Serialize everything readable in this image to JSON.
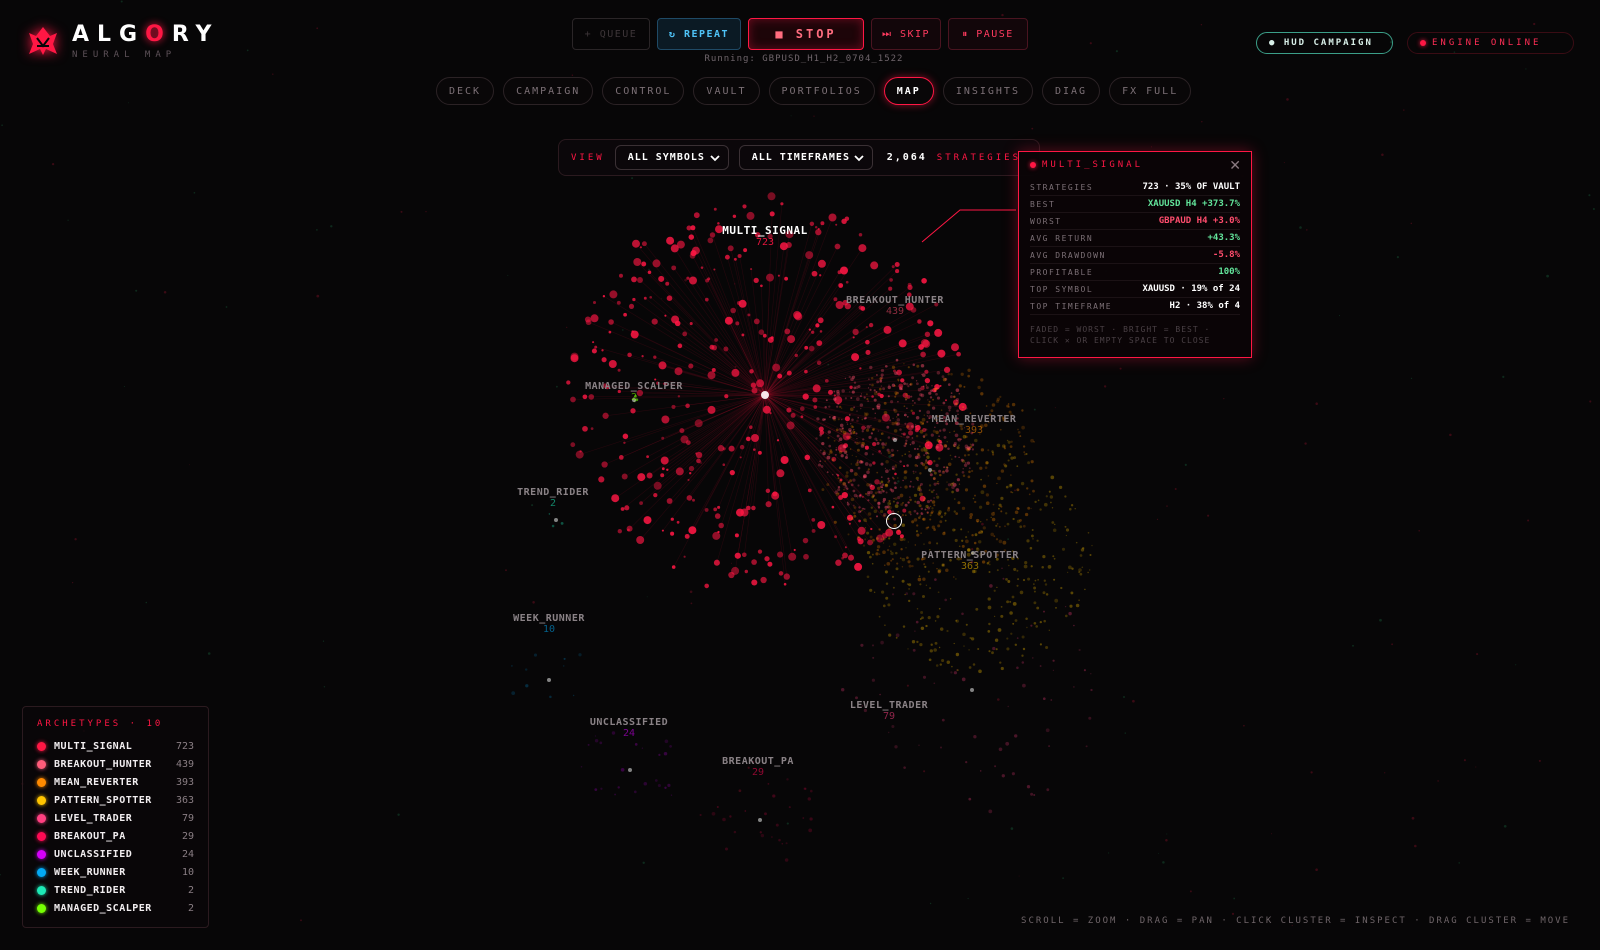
{
  "brand": {
    "name_prefix": "ALG",
    "name_hl": "O",
    "name_suffix": "RY",
    "subtitle": "NEURAL MAP"
  },
  "controls": {
    "queue": "+ QUEUE",
    "repeat": "↻ REPEAT",
    "stop": "■ STOP",
    "skip": "⏭ SKIP",
    "pause": "⏸ PAUSE",
    "running": "Running: GBPUSD_H1_H2_0704_1522"
  },
  "status": {
    "hud": "● HUD CAMPAIGN",
    "engine": "ENGINE ONLINE",
    "engine_color": "#ff1744"
  },
  "tabs": [
    {
      "label": "DECK",
      "active": false
    },
    {
      "label": "CAMPAIGN",
      "active": false
    },
    {
      "label": "CONTROL",
      "active": false
    },
    {
      "label": "VAULT",
      "active": false
    },
    {
      "label": "PORTFOLIOS",
      "active": false
    },
    {
      "label": "MAP",
      "active": true
    },
    {
      "label": "INSIGHTS",
      "active": false
    },
    {
      "label": "DIAG",
      "active": false
    },
    {
      "label": "FX FULL",
      "active": false
    }
  ],
  "viewbar": {
    "label": "VIEW",
    "symbols": "ALL SYMBOLS",
    "timeframes": "ALL TIMEFRAMES",
    "count": "2,064",
    "count_label": "STRATEGIES"
  },
  "clusters": [
    {
      "name": "MULTI_SIGNAL",
      "count": "723",
      "color": "#ff1744",
      "main": true
    },
    {
      "name": "BREAKOUT_HUNTER",
      "count": "439",
      "color": "#ff4d6d"
    },
    {
      "name": "MANAGED_SCALPER",
      "count": "2",
      "color": "#76ff03"
    },
    {
      "name": "MEAN_REVERTER",
      "count": "393",
      "color": "#ff8a00"
    },
    {
      "name": "TREND_RIDER",
      "count": "2",
      "color": "#1de9b6"
    },
    {
      "name": "PATTERN_SPOTTER",
      "count": "363",
      "color": "#ffc400"
    },
    {
      "name": "WEEK_RUNNER",
      "count": "10",
      "color": "#03a9f4"
    },
    {
      "name": "LEVEL_TRADER",
      "count": "79",
      "color": "#ff4081"
    },
    {
      "name": "UNCLASSIFIED",
      "count": "24",
      "color": "#d500f9"
    },
    {
      "name": "BREAKOUT_PA",
      "count": "29",
      "color": "#ff0a54"
    }
  ],
  "inspect": {
    "title": "MULTI_SIGNAL",
    "rows": [
      {
        "key": "STRATEGIES",
        "value": "723 · 35% OF VAULT",
        "tone": ""
      },
      {
        "key": "BEST",
        "value": "XAUUSD H4 +373.7%",
        "tone": "pos"
      },
      {
        "key": "WORST",
        "value": "GBPAUD H4 +3.0%",
        "tone": "neg"
      },
      {
        "key": "AVG RETURN",
        "value": "+43.3%",
        "tone": "pos"
      },
      {
        "key": "AVG DRAWDOWN",
        "value": "-5.8%",
        "tone": "neg"
      },
      {
        "key": "PROFITABLE",
        "value": "100%",
        "tone": "pos"
      },
      {
        "key": "TOP SYMBOL",
        "value": "XAUUSD · 19% of 24",
        "tone": ""
      },
      {
        "key": "TOP TIMEFRAME",
        "value": "H2 · 38% of 4",
        "tone": ""
      }
    ],
    "footer_1": "FADED = WORST · BRIGHT = BEST ·",
    "footer_2": "CLICK ✕ OR EMPTY SPACE TO CLOSE"
  },
  "legend": {
    "title": "ARCHETYPES · 10",
    "items": [
      {
        "name": "MULTI_SIGNAL",
        "count": "723",
        "color": "#ff1744"
      },
      {
        "name": "BREAKOUT_HUNTER",
        "count": "439",
        "color": "#ff5c7a"
      },
      {
        "name": "MEAN_REVERTER",
        "count": "393",
        "color": "#ff8a00"
      },
      {
        "name": "PATTERN_SPOTTER",
        "count": "363",
        "color": "#ffc400"
      },
      {
        "name": "LEVEL_TRADER",
        "count": "79",
        "color": "#ff4081"
      },
      {
        "name": "BREAKOUT_PA",
        "count": "29",
        "color": "#ff0a54"
      },
      {
        "name": "UNCLASSIFIED",
        "count": "24",
        "color": "#d500f9"
      },
      {
        "name": "WEEK_RUNNER",
        "count": "10",
        "color": "#03a9f4"
      },
      {
        "name": "TREND_RIDER",
        "count": "2",
        "color": "#1de9b6"
      },
      {
        "name": "MANAGED_SCALPER",
        "count": "2",
        "color": "#76ff03"
      }
    ]
  },
  "hints": "SCROLL = ZOOM   ·   DRAG = PAN   ·   CLICK CLUSTER = INSPECT   ·   DRAG CLUSTER = MOVE"
}
